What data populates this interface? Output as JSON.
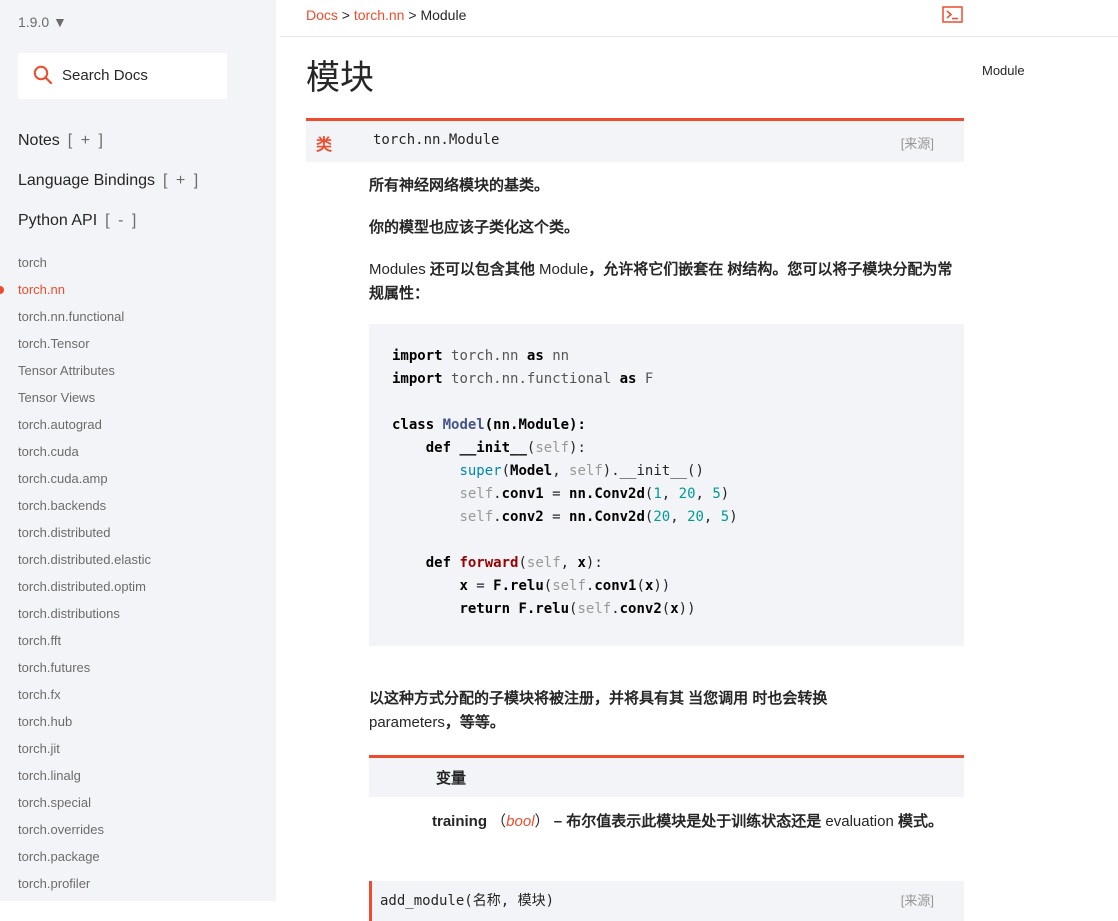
{
  "sidebar": {
    "version": "1.9.0 ▼",
    "search_placeholder": "Search Docs",
    "sections": [
      {
        "label": "Notes",
        "toggle": "[ + ]"
      },
      {
        "label": "Language Bindings",
        "toggle": "[ + ]"
      },
      {
        "label": "Python API",
        "toggle": "[ - ]"
      }
    ],
    "items": [
      "torch",
      "torch.nn",
      "torch.nn.functional",
      "torch.Tensor",
      "Tensor Attributes",
      "Tensor Views",
      "torch.autograd",
      "torch.cuda",
      "torch.cuda.amp",
      "torch.backends",
      "torch.distributed",
      "torch.distributed.elastic",
      "torch.distributed.optim",
      "torch.distributions",
      "torch.fft",
      "torch.futures",
      "torch.fx",
      "torch.hub",
      "torch.jit",
      "torch.linalg",
      "torch.special",
      "torch.overrides",
      "torch.package",
      "torch.profiler"
    ],
    "active_item": "torch.nn"
  },
  "breadcrumb": {
    "docs": "Docs",
    "sep": ">",
    "nn": "torch.nn",
    "current": "Module"
  },
  "rightnav": {
    "item": "Module"
  },
  "page": {
    "title": "模块",
    "signature": {
      "kind": "类",
      "name": "torch.nn.Module",
      "source": "[来源]"
    },
    "para1": "所有神经网络模块的基类。",
    "para2": "你的模型也应该子类化这个类。",
    "para3_a": "Modules",
    "para3_b": " 还可以包含其他 ",
    "para3_c": "Module",
    "para3_d": "，允许将它们嵌套在 树结构。您可以将子模块分配为常规属性：",
    "para4_a": "以这种方式分配的子模块将被注册，并将具有其 当您调用  时也会转换 ",
    "para4_b": "parameters",
    "para4_c": "，等等。",
    "vars_label": "变量",
    "training_name": "training",
    "training_open": " （",
    "training_type": "bool",
    "training_close": "）",
    "training_desc_a": " – 布尔值表示此模块是处于训练状态还是 ",
    "training_desc_b": "evaluation",
    "training_desc_c": " 模式。",
    "next_sig_name": "add_module(名称, 模块)",
    "next_sig_source": "[来源]"
  }
}
